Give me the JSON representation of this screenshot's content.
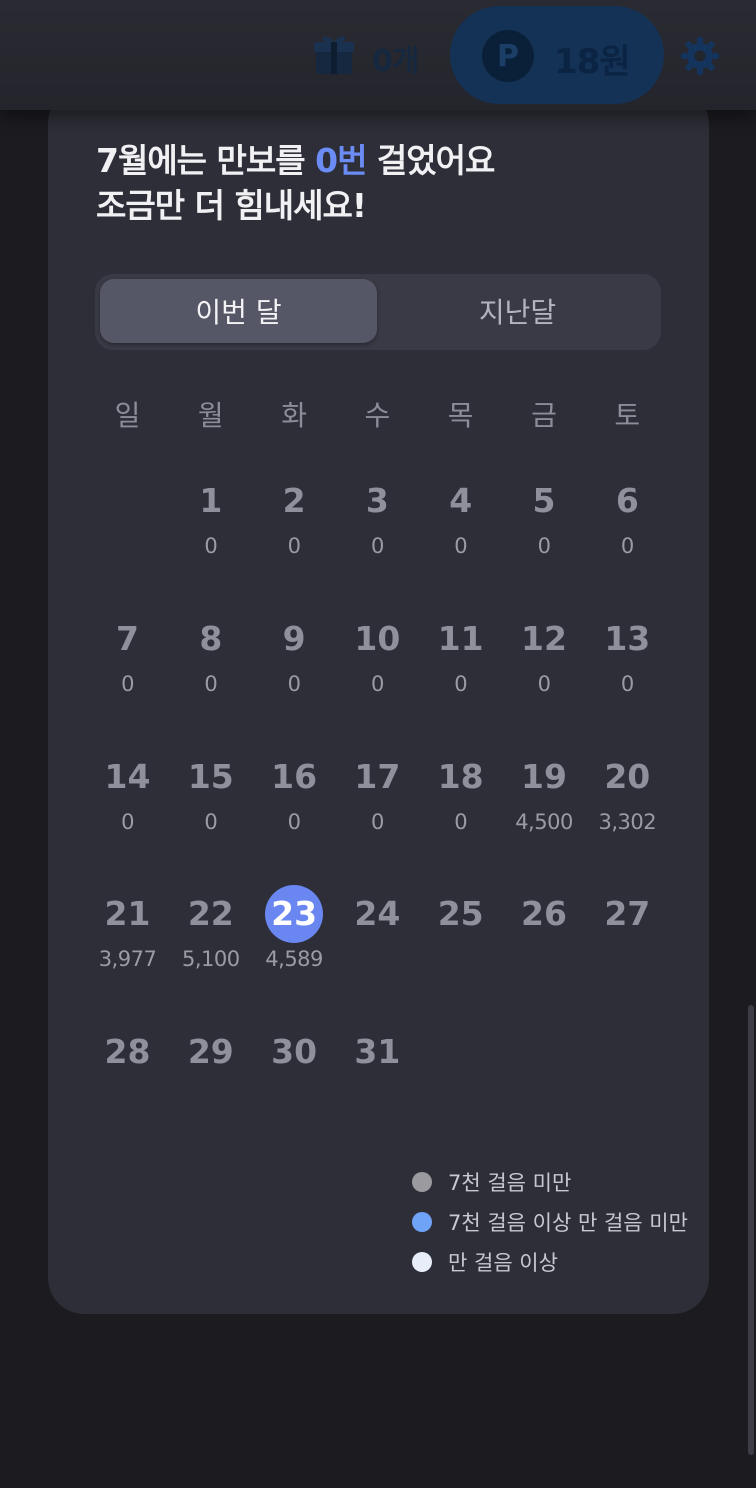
{
  "topbar": {
    "gift_count": "0개",
    "point_symbol": "P",
    "point_value": "18원"
  },
  "headline": {
    "line1_prefix": "7월에는 만보를 ",
    "line1_highlight": "0번",
    "line1_suffix": " 걸었어요",
    "line2": "조금만 더 힘내세요!"
  },
  "tabs": [
    {
      "label": "이번 달",
      "active": true
    },
    {
      "label": "지난달",
      "active": false
    }
  ],
  "weekdays": [
    "일",
    "월",
    "화",
    "수",
    "목",
    "금",
    "토"
  ],
  "calendar": {
    "days": [
      {
        "day": "1",
        "steps": "0"
      },
      {
        "day": "2",
        "steps": "0"
      },
      {
        "day": "3",
        "steps": "0"
      },
      {
        "day": "4",
        "steps": "0"
      },
      {
        "day": "5",
        "steps": "0"
      },
      {
        "day": "6",
        "steps": "0"
      },
      {
        "day": "7",
        "steps": "0"
      },
      {
        "day": "8",
        "steps": "0"
      },
      {
        "day": "9",
        "steps": "0"
      },
      {
        "day": "10",
        "steps": "0"
      },
      {
        "day": "11",
        "steps": "0"
      },
      {
        "day": "12",
        "steps": "0"
      },
      {
        "day": "13",
        "steps": "0"
      },
      {
        "day": "14",
        "steps": "0"
      },
      {
        "day": "15",
        "steps": "0"
      },
      {
        "day": "16",
        "steps": "0"
      },
      {
        "day": "17",
        "steps": "0"
      },
      {
        "day": "18",
        "steps": "0"
      },
      {
        "day": "19",
        "steps": "4,500"
      },
      {
        "day": "20",
        "steps": "3,302"
      },
      {
        "day": "21",
        "steps": "3,977"
      },
      {
        "day": "22",
        "steps": "5,100"
      },
      {
        "day": "23",
        "steps": "4,589",
        "today": true
      },
      {
        "day": "24",
        "steps": ""
      },
      {
        "day": "25",
        "steps": ""
      },
      {
        "day": "26",
        "steps": ""
      },
      {
        "day": "27",
        "steps": ""
      },
      {
        "day": "28",
        "steps": ""
      },
      {
        "day": "29",
        "steps": ""
      },
      {
        "day": "30",
        "steps": ""
      },
      {
        "day": "31",
        "steps": ""
      }
    ],
    "first_weekday_index": 1
  },
  "legend": [
    {
      "label": "7천 걸음 미만",
      "color": "#9a9a9f"
    },
    {
      "label": "7천 걸음 이상 만 걸음 미만",
      "color": "#6fa3f7"
    },
    {
      "label": "만 걸음 이상",
      "color": "#e8eef9"
    }
  ],
  "colors": {
    "accent": "#6a86f0",
    "headline_highlight": "#6b8cf5"
  }
}
